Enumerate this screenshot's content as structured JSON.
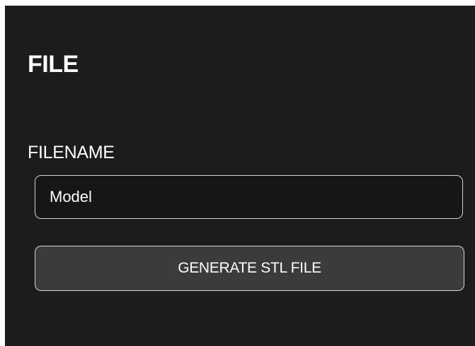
{
  "section": {
    "title": "FILE"
  },
  "filename": {
    "label": "FILENAME",
    "value": "Model"
  },
  "actions": {
    "generate_label": "GENERATE STL FILE"
  }
}
